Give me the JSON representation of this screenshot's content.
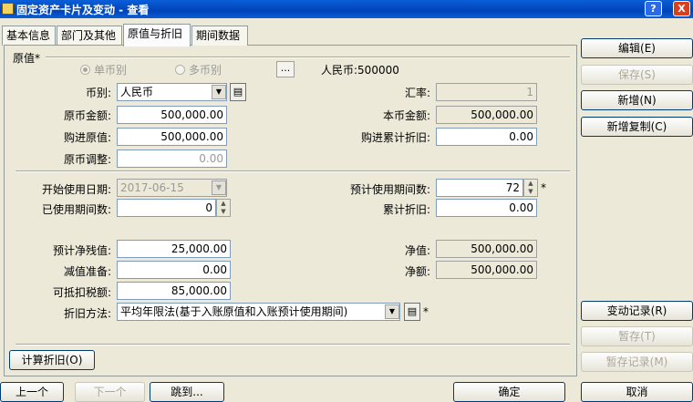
{
  "window": {
    "title": "固定资产卡片及变动 - 查看",
    "help_label": "?",
    "close_label": "X"
  },
  "tabs": [
    {
      "label": "基本信息"
    },
    {
      "label": "部门及其他"
    },
    {
      "label": "原值与折旧"
    },
    {
      "label": "期间数据"
    }
  ],
  "section_title": "原值*",
  "currency_mode": {
    "single_label": "单币别",
    "multi_label": "多币别",
    "selected": "单币别",
    "ellipsis": "...",
    "summary": "人民币:500000"
  },
  "form": {
    "currency_label": "币别:",
    "currency_value": "人民币",
    "rate_label": "汇率:",
    "rate_value": "1",
    "orig_amount_label": "原币金额:",
    "orig_amount_value": "500,000.00",
    "local_amount_label": "本币金额:",
    "local_amount_value": "500,000.00",
    "purchase_orig_label": "购进原值:",
    "purchase_orig_value": "500,000.00",
    "purchase_dep_label": "购进累计折旧:",
    "purchase_dep_value": "0.00",
    "orig_adjust_label": "原币调整:",
    "orig_adjust_value": "0.00",
    "start_date_label": "开始使用日期:",
    "start_date_value": "2017-06-15",
    "expected_periods_label": "预计使用期间数:",
    "expected_periods_value": "72",
    "used_periods_label": "已使用期间数:",
    "used_periods_value": "0",
    "accum_dep_label": "累计折旧:",
    "accum_dep_value": "0.00",
    "residual_label": "预计净残值:",
    "residual_value": "25,000.00",
    "net_value_label": "净值:",
    "net_value_value": "500,000.00",
    "impairment_label": "减值准备:",
    "impairment_value": "0.00",
    "net_amount_label": "净额:",
    "net_amount_value": "500,000.00",
    "deductible_tax_label": "可抵扣税额:",
    "deductible_tax_value": "85,000.00",
    "dep_method_label": "折旧方法:",
    "dep_method_value": "平均年限法(基于入账原值和入账预计使用期间)",
    "required_mark": "*"
  },
  "buttons": {
    "calc_dep": "计算折旧(O)",
    "edit": "编辑(E)",
    "save": "保存(S)",
    "add": "新增(N)",
    "add_copy": "新增复制(C)",
    "change_record": "变动记录(R)",
    "hold": "暂存(T)",
    "hold_record": "暂存记录(M)",
    "prev": "上一个",
    "next": "下一个",
    "jump": "跳到...",
    "ok": "确定",
    "cancel": "取消"
  },
  "icons": {
    "ref": "lookup-icon"
  }
}
